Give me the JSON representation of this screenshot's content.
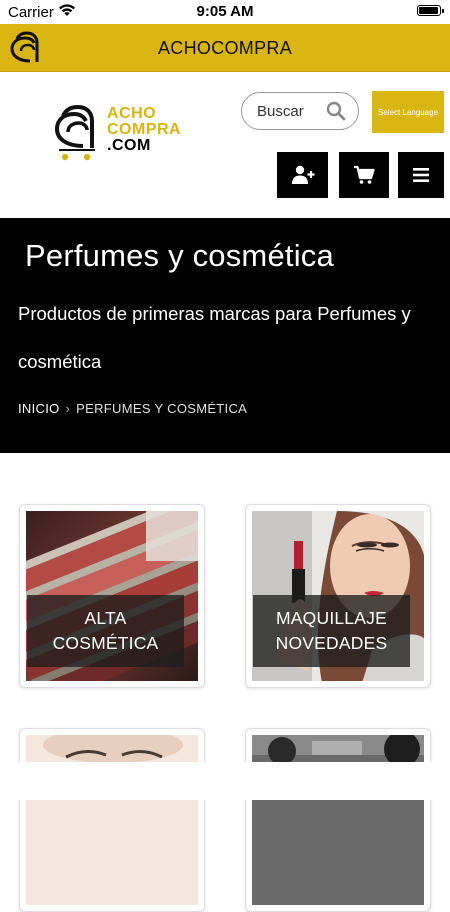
{
  "status_bar": {
    "carrier": "Carrier",
    "time": "9:05 AM"
  },
  "app_bar": {
    "title": "ACHOCOMPRA"
  },
  "logo": {
    "line1": "ACHO",
    "line2": "COMPRA",
    "line3": ".COM"
  },
  "search": {
    "placeholder": "Buscar"
  },
  "language": {
    "label": "Select Language"
  },
  "hero": {
    "title": "Perfumes y cosmética",
    "subtitle": "Productos de primeras marcas para Perfumes y cosmética"
  },
  "breadcrumb": {
    "home": "INICIO",
    "current": "PERFUMES Y COSMÉTICA"
  },
  "categories": [
    {
      "line1": "ALTA",
      "line2": "COSMÉTICA"
    },
    {
      "line1": "MAQUILLAJE",
      "line2": "NOVEDADES"
    }
  ],
  "colors": {
    "brand_yellow": "#d8b511",
    "hero_bg": "#000000",
    "button_bg": "#000000"
  },
  "icons": [
    "wifi-icon",
    "battery-icon",
    "search-icon",
    "add-user-icon",
    "cart-icon",
    "menu-icon"
  ]
}
